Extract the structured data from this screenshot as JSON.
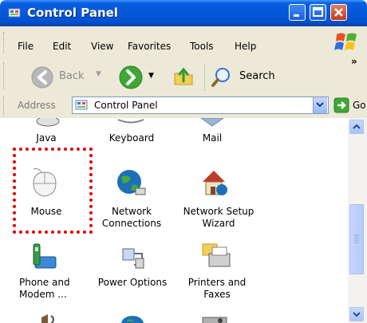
{
  "window": {
    "title": "Control Panel"
  },
  "menu": [
    "File",
    "Edit",
    "View",
    "Favorites",
    "Tools",
    "Help"
  ],
  "toolbar": {
    "back_label": "Back",
    "search_label": "Search",
    "more": "»"
  },
  "address": {
    "label": "Address",
    "value": "Control Panel",
    "go_label": "Go"
  },
  "items": [
    {
      "label": "Java"
    },
    {
      "label": "Keyboard"
    },
    {
      "label": "Mail"
    },
    {
      "label": "Mouse"
    },
    {
      "label": "Network Connections"
    },
    {
      "label": "Network Setup Wizard"
    },
    {
      "label": "Phone and Modem ..."
    },
    {
      "label": "Power Options"
    },
    {
      "label": "Printers and Faxes"
    }
  ],
  "colors": {
    "title_bar": "#0558d8",
    "highlight": "#e00000"
  }
}
